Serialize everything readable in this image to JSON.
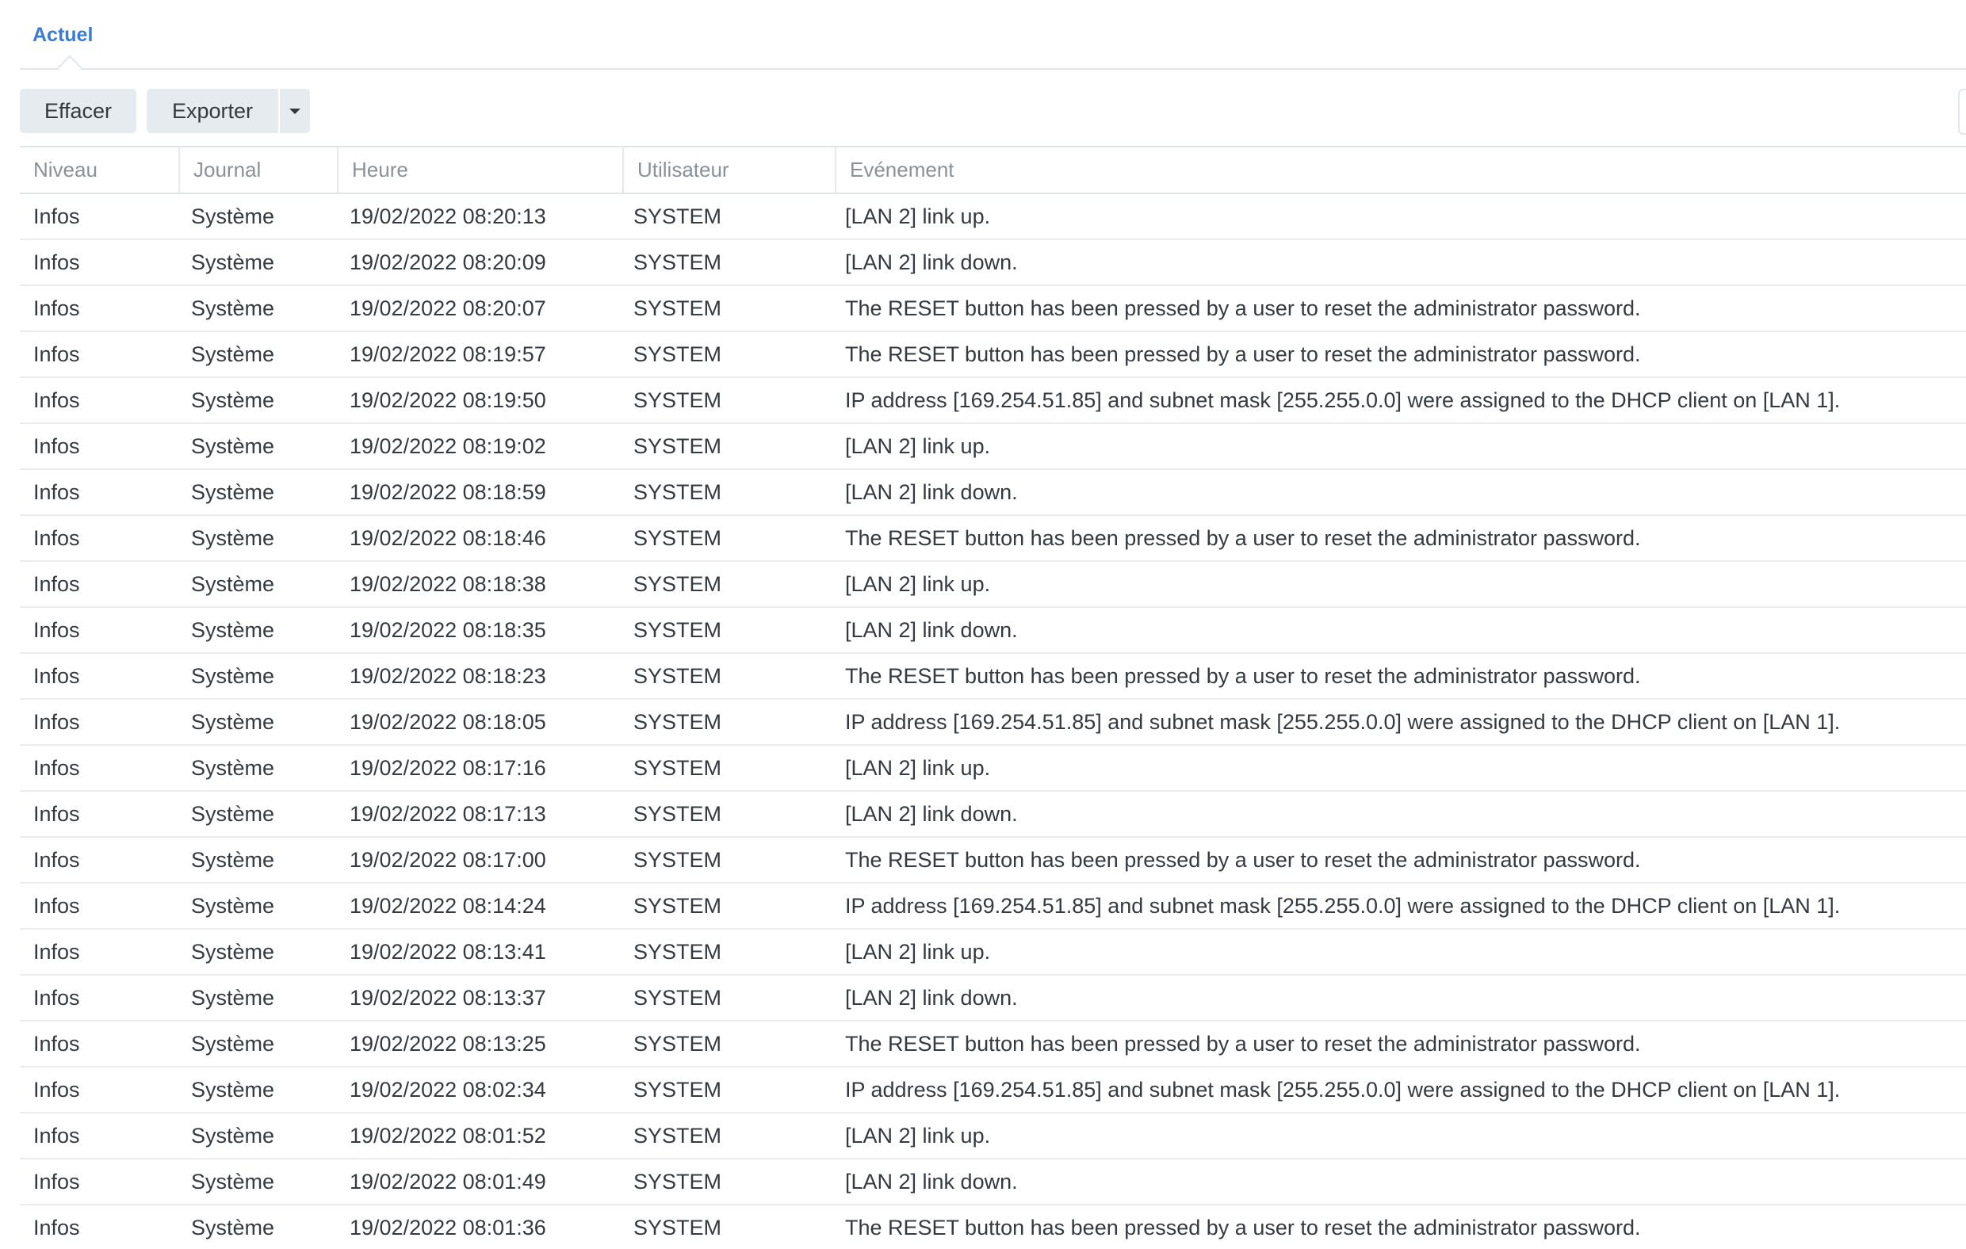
{
  "tabs": [
    {
      "label": "Actuel",
      "active": true
    }
  ],
  "toolbar": {
    "clear_label": "Effacer",
    "export_label": "Exporter"
  },
  "table": {
    "columns": [
      "Niveau",
      "Journal",
      "Heure",
      "Utilisateur",
      "Evénement"
    ],
    "rows": [
      [
        "Infos",
        "Système",
        "19/02/2022 08:20:13",
        "SYSTEM",
        "[LAN 2] link up."
      ],
      [
        "Infos",
        "Système",
        "19/02/2022 08:20:09",
        "SYSTEM",
        "[LAN 2] link down."
      ],
      [
        "Infos",
        "Système",
        "19/02/2022 08:20:07",
        "SYSTEM",
        "The RESET button has been pressed by a user to reset the administrator password."
      ],
      [
        "Infos",
        "Système",
        "19/02/2022 08:19:57",
        "SYSTEM",
        "The RESET button has been pressed by a user to reset the administrator password."
      ],
      [
        "Infos",
        "Système",
        "19/02/2022 08:19:50",
        "SYSTEM",
        "IP address [169.254.51.85] and subnet mask [255.255.0.0] were assigned to the DHCP client on [LAN 1]."
      ],
      [
        "Infos",
        "Système",
        "19/02/2022 08:19:02",
        "SYSTEM",
        "[LAN 2] link up."
      ],
      [
        "Infos",
        "Système",
        "19/02/2022 08:18:59",
        "SYSTEM",
        "[LAN 2] link down."
      ],
      [
        "Infos",
        "Système",
        "19/02/2022 08:18:46",
        "SYSTEM",
        "The RESET button has been pressed by a user to reset the administrator password."
      ],
      [
        "Infos",
        "Système",
        "19/02/2022 08:18:38",
        "SYSTEM",
        "[LAN 2] link up."
      ],
      [
        "Infos",
        "Système",
        "19/02/2022 08:18:35",
        "SYSTEM",
        "[LAN 2] link down."
      ],
      [
        "Infos",
        "Système",
        "19/02/2022 08:18:23",
        "SYSTEM",
        "The RESET button has been pressed by a user to reset the administrator password."
      ],
      [
        "Infos",
        "Système",
        "19/02/2022 08:18:05",
        "SYSTEM",
        "IP address [169.254.51.85] and subnet mask [255.255.0.0] were assigned to the DHCP client on [LAN 1]."
      ],
      [
        "Infos",
        "Système",
        "19/02/2022 08:17:16",
        "SYSTEM",
        "[LAN 2] link up."
      ],
      [
        "Infos",
        "Système",
        "19/02/2022 08:17:13",
        "SYSTEM",
        "[LAN 2] link down."
      ],
      [
        "Infos",
        "Système",
        "19/02/2022 08:17:00",
        "SYSTEM",
        "The RESET button has been pressed by a user to reset the administrator password."
      ],
      [
        "Infos",
        "Système",
        "19/02/2022 08:14:24",
        "SYSTEM",
        "IP address [169.254.51.85] and subnet mask [255.255.0.0] were assigned to the DHCP client on [LAN 1]."
      ],
      [
        "Infos",
        "Système",
        "19/02/2022 08:13:41",
        "SYSTEM",
        "[LAN 2] link up."
      ],
      [
        "Infos",
        "Système",
        "19/02/2022 08:13:37",
        "SYSTEM",
        "[LAN 2] link down."
      ],
      [
        "Infos",
        "Système",
        "19/02/2022 08:13:25",
        "SYSTEM",
        "The RESET button has been pressed by a user to reset the administrator password."
      ],
      [
        "Infos",
        "Système",
        "19/02/2022 08:02:34",
        "SYSTEM",
        "IP address [169.254.51.85] and subnet mask [255.255.0.0] were assigned to the DHCP client on [LAN 1]."
      ],
      [
        "Infos",
        "Système",
        "19/02/2022 08:01:52",
        "SYSTEM",
        "[LAN 2] link up."
      ],
      [
        "Infos",
        "Système",
        "19/02/2022 08:01:49",
        "SYSTEM",
        "[LAN 2] link down."
      ],
      [
        "Infos",
        "Système",
        "19/02/2022 08:01:36",
        "SYSTEM",
        "The RESET button has been pressed by a user to reset the administrator password."
      ]
    ]
  },
  "colors": {
    "accent": "#3a7bd5",
    "button_bg": "#e6ebef",
    "header_text": "#8a9199",
    "body_text": "#343a40",
    "row_divider": "#e9edf0"
  },
  "icons": {
    "export_dropdown": "caret-down-icon"
  }
}
